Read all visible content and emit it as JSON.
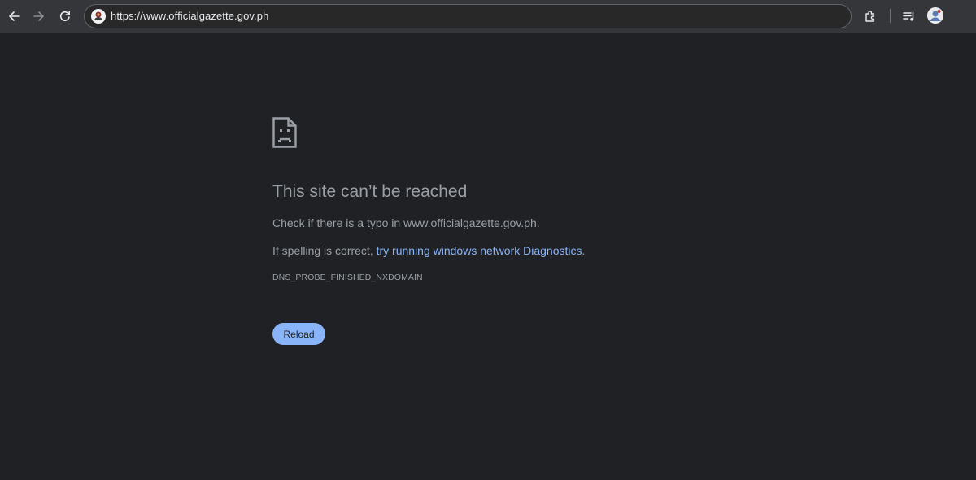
{
  "toolbar": {
    "url": "https://www.officialgazette.gov.ph",
    "back_icon": "arrow-left-icon",
    "forward_icon": "arrow-right-icon",
    "reload_icon": "refresh-icon",
    "extensions_icon": "puzzle-icon",
    "media_icon": "queue-music-icon",
    "profile_icon": "avatar"
  },
  "error_page": {
    "icon": "sad-page-icon",
    "title": "This site can’t be reached",
    "line1": "Check if there is a typo in www.officialgazette.gov.ph.",
    "line2_prefix": "If spelling is correct, ",
    "line2_link": "try running windows network Diagnostics",
    "line2_suffix": ".",
    "error_code": "DNS_PROBE_FINISHED_NXDOMAIN",
    "reload_label": "Reload"
  },
  "colors": {
    "background": "#202124",
    "toolbar": "#35363a",
    "text": "#9aa0a6",
    "link": "#8ab4f8",
    "button": "#8ab4f8"
  }
}
